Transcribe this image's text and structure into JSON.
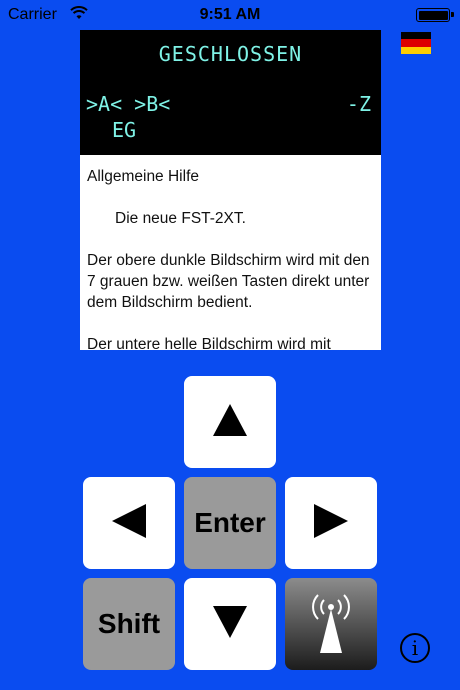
{
  "status_bar": {
    "carrier": "Carrier",
    "time": "9:51 AM",
    "wifi_icon": "wifi-icon",
    "battery_icon": "battery-icon"
  },
  "language_flag": {
    "icon": "german-flag-icon",
    "colors": [
      "#000000",
      "#dd0000",
      "#ffce00"
    ]
  },
  "terminal": {
    "line1": "GESCHLOSSEN",
    "line2_left": ">A< >B<",
    "line2_right": "-Z",
    "line3": "EG",
    "text_color": "#7ff2e6"
  },
  "help": {
    "title": "Allgemeine Hilfe",
    "subtitle": "Die neue FST-2XT.",
    "para1": "Der obere dunkle Bildschirm wird mit den 7 grauen bzw. weißen Tasten direkt unter dem Bildschirm bedient.",
    "para2": "Der untere helle Bildschirm wird mit"
  },
  "keys": {
    "up_icon": "arrow-up-icon",
    "left_icon": "arrow-left-icon",
    "right_icon": "arrow-right-icon",
    "down_icon": "arrow-down-icon",
    "enter_label": "Enter",
    "shift_label": "Shift",
    "radio_icon": "radio-antenna-icon"
  },
  "info_label": "i",
  "colors": {
    "background": "#0a4cf0",
    "key_white": "#ffffff",
    "key_gray": "#9a9a9a"
  }
}
